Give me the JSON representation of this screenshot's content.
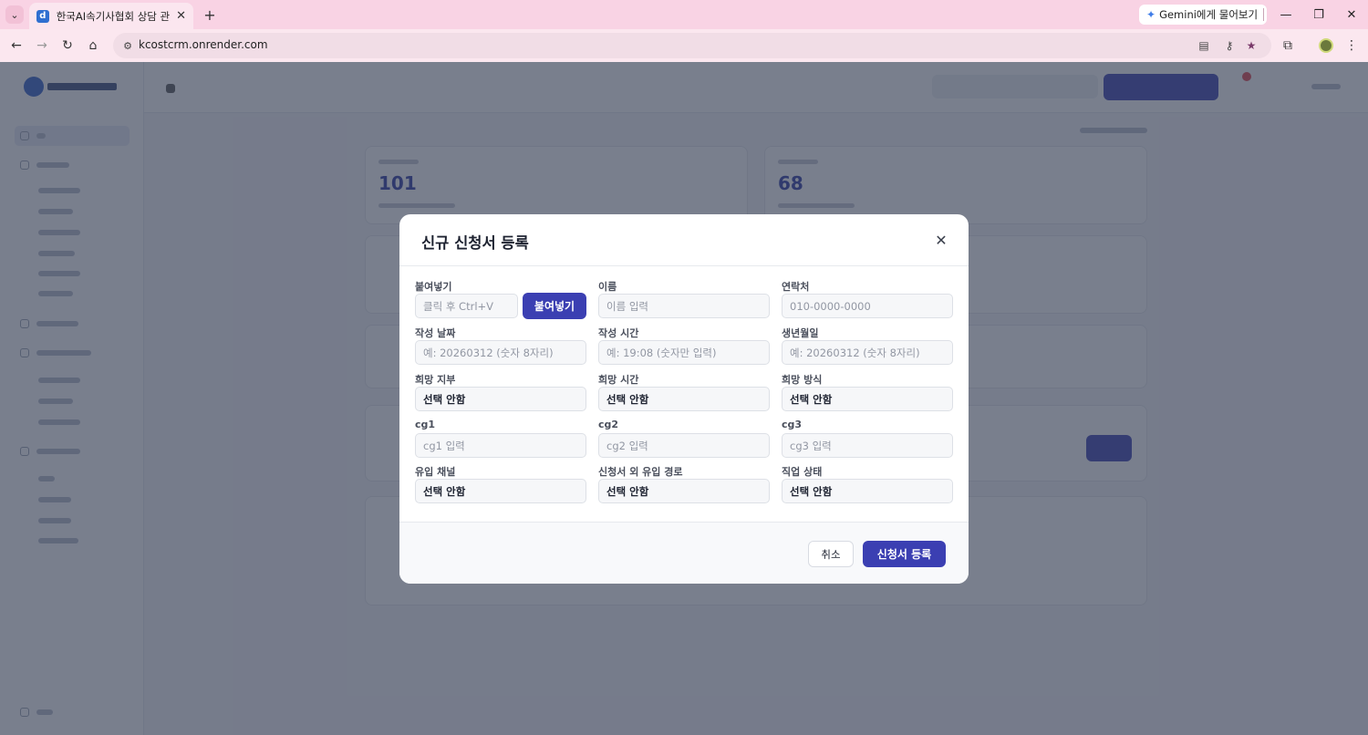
{
  "browser": {
    "tab_title": "한국AI속기사협회 상담 관리 시",
    "tab_favicon_letter": "d",
    "url": "kcostcrm.onrender.com",
    "gemini_label": "Gemini에게 물어보기"
  },
  "page_behind": {
    "card_values": [
      "101",
      "68"
    ]
  },
  "modal": {
    "title": "신규 신청서 등록",
    "fields": {
      "paste": {
        "label": "붙여넣기",
        "placeholder": "클릭 후 Ctrl+V",
        "button": "붙여넣기"
      },
      "name": {
        "label": "이름",
        "placeholder": "이름 입력"
      },
      "contact": {
        "label": "연락처",
        "placeholder": "010-0000-0000"
      },
      "write_date": {
        "label": "작성 날짜",
        "placeholder": "예: 20260312 (숫자 8자리)"
      },
      "write_time": {
        "label": "작성 시간",
        "placeholder": "예: 19:08 (숫자만 입력)"
      },
      "birthdate": {
        "label": "생년월일",
        "placeholder": "예: 20260312 (숫자 8자리)"
      },
      "branch": {
        "label": "희망 지부",
        "value": "선택 안함"
      },
      "hope_time": {
        "label": "희망 시간",
        "value": "선택 안함"
      },
      "hope_method": {
        "label": "희망 방식",
        "value": "선택 안함"
      },
      "cg1": {
        "label": "cg1",
        "placeholder": "cg1 입력"
      },
      "cg2": {
        "label": "cg2",
        "placeholder": "cg2 입력"
      },
      "cg3": {
        "label": "cg3",
        "placeholder": "cg3 입력"
      },
      "channel": {
        "label": "유입 채널",
        "value": "선택 안함"
      },
      "other_route": {
        "label": "신청서 외 유입 경로",
        "value": "선택 안함"
      },
      "job_status": {
        "label": "직업 상태",
        "value": "선택 안함"
      }
    },
    "cancel_label": "취소",
    "submit_label": "신청서 등록"
  },
  "colors": {
    "accent": "#3b3fb2",
    "tabbar": "#f9d3e4",
    "overlay": "rgba(52,60,82,0.66)"
  }
}
